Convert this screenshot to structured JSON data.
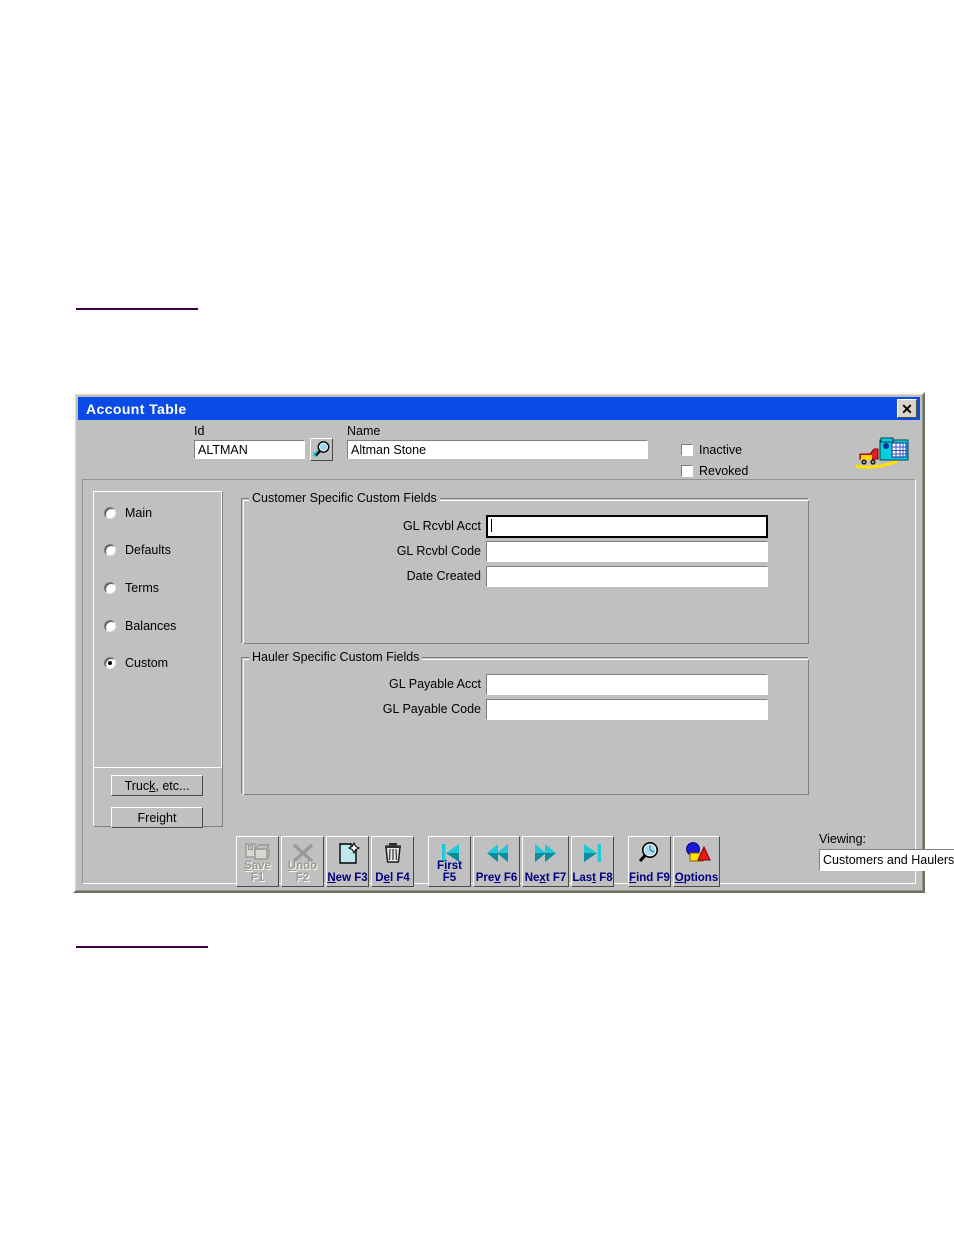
{
  "page": {
    "rule_color": "#3f0040"
  },
  "window": {
    "title": "Account Table",
    "close_label": "✕",
    "titlebar_color": "#0a4ae6",
    "face_color": "#c0c0c0"
  },
  "header": {
    "id_label": "Id",
    "id_value": "ALTMAN",
    "id_search_icon": "magnifier-icon",
    "name_label": "Name",
    "name_value": "Altman Stone",
    "checkboxes": [
      {
        "label": "Inactive",
        "checked": false
      },
      {
        "label": "Revoked",
        "checked": false
      }
    ],
    "company_icon": "truck-and-building-icon"
  },
  "nav": {
    "radios": [
      {
        "label": "Main",
        "selected": false
      },
      {
        "label": "Defaults",
        "selected": false
      },
      {
        "label": "Terms",
        "selected": false
      },
      {
        "label": "Balances",
        "selected": false
      },
      {
        "label": "Custom",
        "selected": true
      }
    ],
    "buttons": [
      {
        "pre": "Truc",
        "accel": "k",
        "post": ", etc..."
      },
      {
        "pre": "Frei",
        "accel": "g",
        "post": "ht"
      }
    ]
  },
  "customer_group": {
    "title": "Customer Specific Custom Fields",
    "fields": [
      {
        "label": "GL Rcvbl Acct",
        "value": "",
        "focused": true
      },
      {
        "label": "GL Rcvbl Code",
        "value": "",
        "focused": false
      },
      {
        "label": "Date Created",
        "value": "",
        "focused": false
      }
    ]
  },
  "hauler_group": {
    "title": "Hauler Specific Custom Fields",
    "fields": [
      {
        "label": "GL Payable Acct",
        "value": "",
        "focused": false
      },
      {
        "label": "GL Payable Code",
        "value": "",
        "focused": false
      }
    ]
  },
  "toolbar": {
    "accent_color": "#000080",
    "buttons": [
      {
        "name": "save",
        "pre": "",
        "accel": "S",
        "post": "ave F1",
        "icon": "save-disk-icon",
        "enabled": false
      },
      {
        "name": "undo",
        "pre": "",
        "accel": "U",
        "post": "ndo F2",
        "icon": "undo-x-icon",
        "enabled": false
      },
      {
        "name": "new",
        "pre": "",
        "accel": "N",
        "post": "ew F3",
        "icon": "new-page-icon",
        "enabled": true
      },
      {
        "name": "delete",
        "pre": "D",
        "accel": "e",
        "post": "l F4",
        "icon": "trash-can-icon",
        "enabled": true
      },
      {
        "name": "first",
        "pre": "F",
        "accel": "i",
        "post": "rst F5",
        "icon": "first-record-icon",
        "enabled": true
      },
      {
        "name": "prev",
        "pre": "Pre",
        "accel": "v",
        "post": " F6",
        "icon": "previous-record-icon",
        "enabled": true
      },
      {
        "name": "next",
        "pre": "Ne",
        "accel": "x",
        "post": "t F7",
        "icon": "next-record-icon",
        "enabled": true
      },
      {
        "name": "last",
        "pre": "Las",
        "accel": "t",
        "post": " F8",
        "icon": "last-record-icon",
        "enabled": true
      },
      {
        "name": "find",
        "pre": "",
        "accel": "F",
        "post": "ind F9",
        "icon": "magnifier-icon",
        "enabled": true
      },
      {
        "name": "options",
        "pre": "",
        "accel": "O",
        "post": "ptions",
        "icon": "shapes-options-icon",
        "enabled": true
      }
    ]
  },
  "viewing": {
    "label": "Viewing:",
    "value": "Customers and Haulers",
    "arrow_icon": "chevron-down-icon"
  }
}
